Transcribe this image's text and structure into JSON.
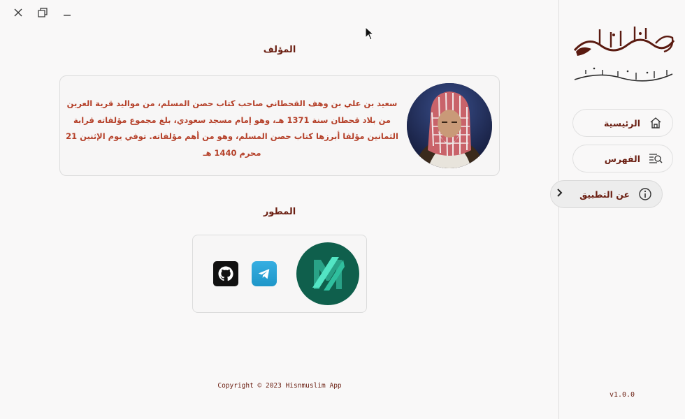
{
  "window": {
    "controls": [
      "close",
      "restore",
      "minimize"
    ]
  },
  "author_section": {
    "title": "المؤلف",
    "bio": "سعيد بن علي بن وهف القحطاني صاحب كتاب حصن المسلم، من مواليد قرية العرين من بلاد قحطان سنة 1371 هـ، وهو إمام مسجد سعودي، بلغ مجموع مؤلفاته قرابة الثمانين مؤلفا أبرزها كتاب حصن المسلم، وهو من أهم مؤلفاته. توفي يوم الإثنين 21 محرم 1440 هـ"
  },
  "developer_section": {
    "title": "المطور",
    "links": [
      "github-icon",
      "telegram-icon"
    ]
  },
  "footer": {
    "copyright": "Copyright © 2023 Hisnmuslim App"
  },
  "sidebar": {
    "logo_title": "حصن المسلم",
    "logo_subtitle": "من أذكار الكتاب والسنة",
    "items": [
      {
        "label": "الرئيسية",
        "icon": "home-icon",
        "active": false
      },
      {
        "label": "الفهرس",
        "icon": "index-search-icon",
        "active": false
      },
      {
        "label": "عن التطبيق",
        "icon": "info-icon",
        "active": true
      }
    ],
    "version": "v1.0.0"
  },
  "colors": {
    "primary_text": "#6b1f12",
    "bio_text": "#b5412a",
    "dev_logo_bg": "#0f5f4c",
    "telegram": "#2aa3da"
  }
}
